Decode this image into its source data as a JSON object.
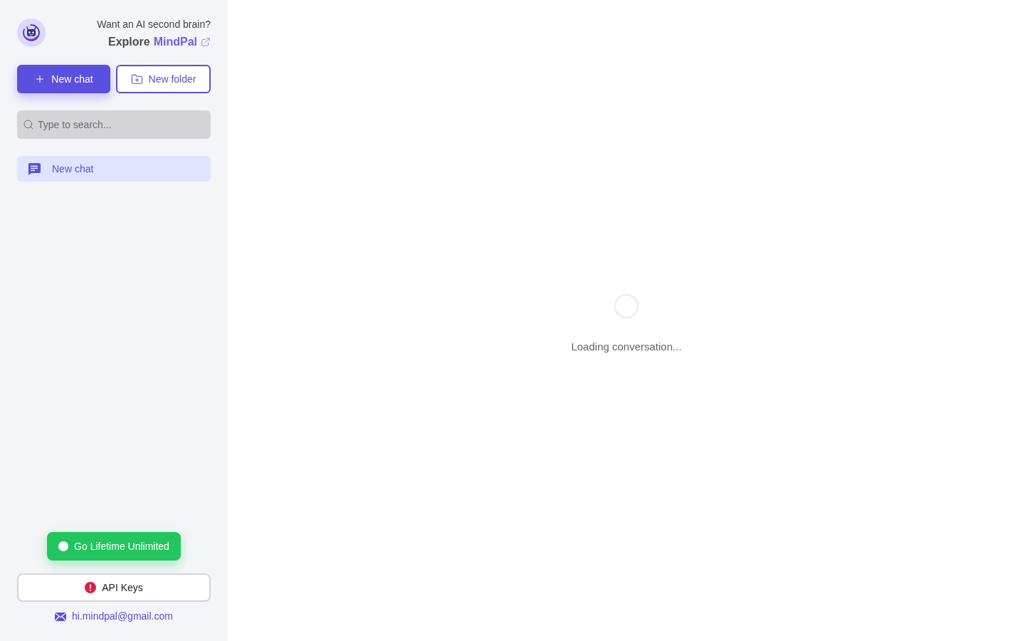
{
  "header": {
    "tagline": "Want an AI second brain?",
    "explore_prefix": "Explore",
    "explore_link": "MindPal"
  },
  "actions": [
    {
      "kind": "primary",
      "label": "New chat"
    },
    {
      "kind": "outline",
      "label": "New folder"
    }
  ],
  "search": {
    "placeholder": "Type to search..."
  },
  "chats": [
    {
      "title": "New chat",
      "selected": true
    }
  ],
  "footer": {
    "upgrade": "Go Lifetime Unlimited",
    "api_keys": "API Keys",
    "api_keys_warning": true,
    "email": "hi.mindpal@gmail.com"
  },
  "main": {
    "status": "Loading conversation..."
  }
}
